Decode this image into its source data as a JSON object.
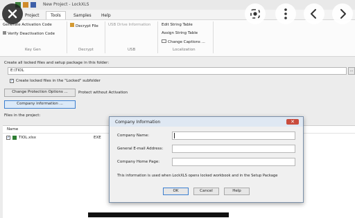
{
  "window": {
    "title": "New Project - LockXLS"
  },
  "tabs": [
    "Project",
    "Tools",
    "Samples",
    "Help"
  ],
  "ribbon": {
    "keygen": {
      "generate": "Generate Activation Code",
      "verify": "Verify Deactivation Code",
      "group": "Key Gen"
    },
    "decrypt": {
      "decrypt_file": "Decrypt File",
      "group": "Decrypt"
    },
    "usb": {
      "usb_drive_info": "USB Drive Information",
      "group": "USB"
    },
    "localization": {
      "edit_string_table": "Edit String Table",
      "assign_string_table": "Assign String Table",
      "change_captions": "Change Captions ...",
      "group": "Localization"
    }
  },
  "main": {
    "folder_label": "Create all locked files and setup package in this folder:",
    "folder_value": "E:\\TIOL",
    "browse": "...",
    "subfolder_checkbox": "Create locked files in the \"Locked\" subfolder",
    "change_protection": "Change Protection Options ...",
    "protect_mode": "Protect without Activation",
    "company_info_button": "Company information ...",
    "files_label": "Files in the project:",
    "column_name": "Name",
    "files": [
      {
        "name": "TIOL.xlsx",
        "type": "EXE"
      }
    ]
  },
  "dialog": {
    "title": "Company Information",
    "company_name_label": "Company Name:",
    "company_name_value": "",
    "email_label": "General E-mail Address:",
    "email_value": "",
    "homepage_label": "Company Home Page:",
    "homepage_value": "",
    "info": "This information is used when LockXLS opens locked workbook and in the Setup Package",
    "ok": "OK",
    "cancel": "Cancel",
    "help": "Help"
  },
  "overlay": {
    "icons": [
      "close-icon",
      "lens-icon",
      "more-icon",
      "back-icon",
      "forward-icon"
    ]
  }
}
